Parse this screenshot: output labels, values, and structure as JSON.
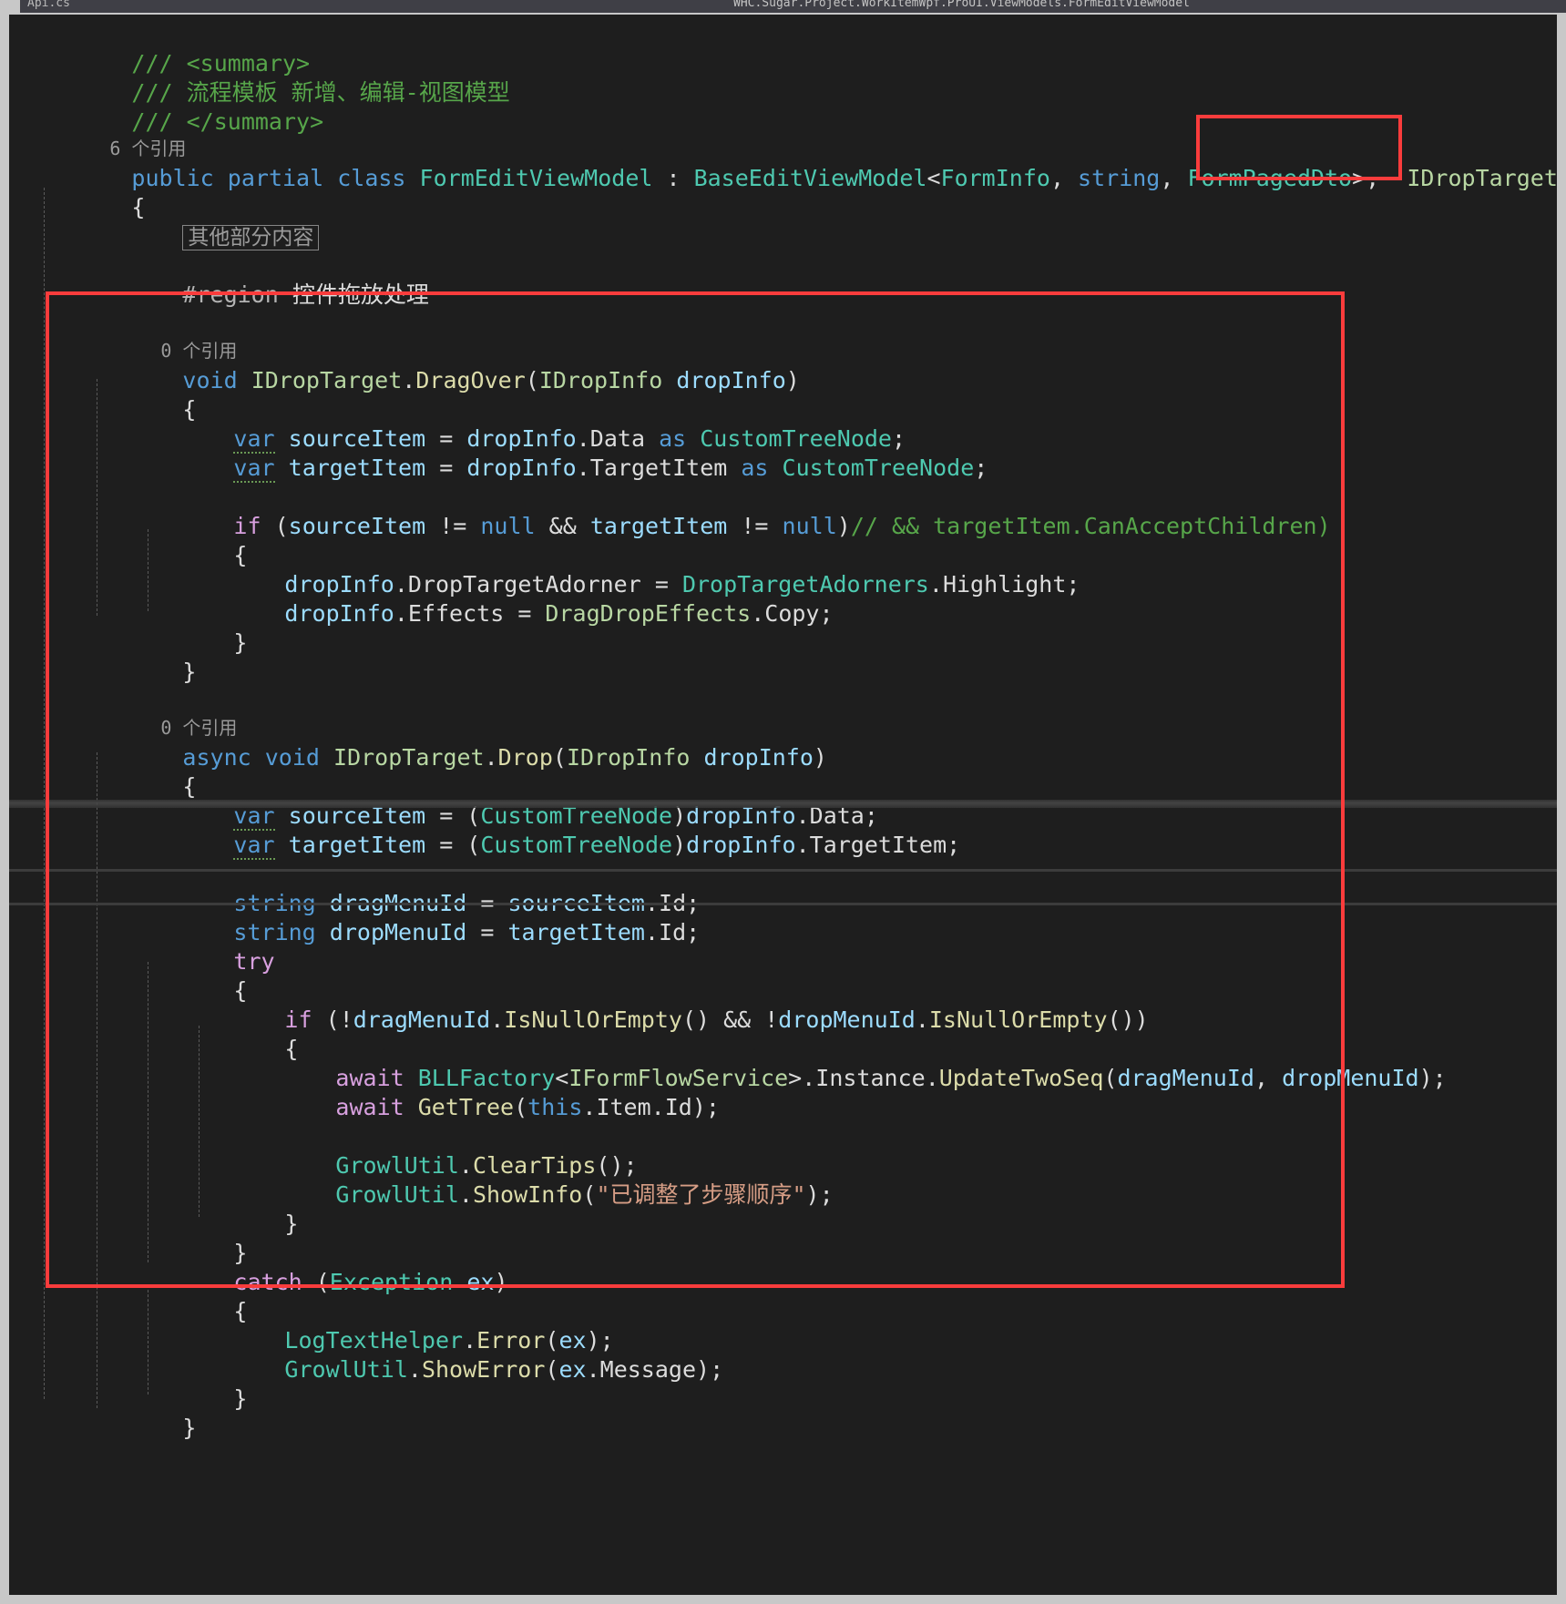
{
  "window": {
    "tab_left_label": "Api.cs",
    "tab_right_label": "WHC.Sugar.Project.WorkItemWpf.ProUI.ViewModels.FormEditViewModel"
  },
  "editor": {
    "language": "csharp",
    "theme": "dark",
    "background": "#1e1e1e",
    "annotation_color": "#fa3c3c",
    "collapsed_region_label": "其他部分内容",
    "lines": [
      {
        "id": "l1",
        "indent": 0,
        "text": "/// <summary>"
      },
      {
        "id": "l2",
        "indent": 0,
        "text": "/// 流程模板 新增、编辑-视图模型"
      },
      {
        "id": "l3",
        "indent": 0,
        "text": "/// </summary>"
      },
      {
        "id": "l4",
        "indent": 0,
        "text": "6 个引用",
        "kind": "codelens"
      },
      {
        "id": "l5",
        "indent": 0,
        "text": "public partial class FormEditViewModel : BaseEditViewModel<FormInfo, string, FormPagedDto>, IDropTarget"
      },
      {
        "id": "l6",
        "indent": 0,
        "text": "{"
      },
      {
        "id": "l7",
        "indent": 1,
        "text": "其他部分内容",
        "kind": "collapsed"
      },
      {
        "id": "l8",
        "indent": 1,
        "text": ""
      },
      {
        "id": "l9",
        "indent": 1,
        "text": "#region 控件拖放处理"
      },
      {
        "id": "l10",
        "indent": 1,
        "text": ""
      },
      {
        "id": "l11",
        "indent": 1,
        "text": "0 个引用",
        "kind": "codelens"
      },
      {
        "id": "l12",
        "indent": 1,
        "text": "void IDropTarget.DragOver(IDropInfo dropInfo)"
      },
      {
        "id": "l13",
        "indent": 1,
        "text": "{"
      },
      {
        "id": "l14",
        "indent": 2,
        "text": "var sourceItem = dropInfo.Data as CustomTreeNode;"
      },
      {
        "id": "l15",
        "indent": 2,
        "text": "var targetItem = dropInfo.TargetItem as CustomTreeNode;"
      },
      {
        "id": "l16",
        "indent": 2,
        "text": ""
      },
      {
        "id": "l17",
        "indent": 2,
        "text": "if (sourceItem != null && targetItem != null)// && targetItem.CanAcceptChildren)"
      },
      {
        "id": "l18",
        "indent": 2,
        "text": "{"
      },
      {
        "id": "l19",
        "indent": 3,
        "text": "dropInfo.DropTargetAdorner = DropTargetAdorners.Highlight;"
      },
      {
        "id": "l20",
        "indent": 3,
        "text": "dropInfo.Effects = DragDropEffects.Copy;"
      },
      {
        "id": "l21",
        "indent": 2,
        "text": "}"
      },
      {
        "id": "l22",
        "indent": 1,
        "text": "}"
      },
      {
        "id": "l23",
        "indent": 1,
        "text": ""
      },
      {
        "id": "l24",
        "indent": 1,
        "text": "0 个引用",
        "kind": "codelens"
      },
      {
        "id": "l25",
        "indent": 1,
        "text": "async void IDropTarget.Drop(IDropInfo dropInfo)"
      },
      {
        "id": "l26",
        "indent": 1,
        "text": "{"
      },
      {
        "id": "l27",
        "indent": 2,
        "text": "var sourceItem = (CustomTreeNode)dropInfo.Data;"
      },
      {
        "id": "l28",
        "indent": 2,
        "text": "var targetItem = (CustomTreeNode)dropInfo.TargetItem;"
      },
      {
        "id": "l29",
        "indent": 2,
        "text": ""
      },
      {
        "id": "l30",
        "indent": 2,
        "text": "string dragMenuId = sourceItem.Id;"
      },
      {
        "id": "l31",
        "indent": 2,
        "text": "string dropMenuId = targetItem.Id;"
      },
      {
        "id": "l32",
        "indent": 2,
        "text": "try"
      },
      {
        "id": "l33",
        "indent": 2,
        "text": "{"
      },
      {
        "id": "l34",
        "indent": 3,
        "text": "if (!dragMenuId.IsNullOrEmpty() && !dropMenuId.IsNullOrEmpty())"
      },
      {
        "id": "l35",
        "indent": 3,
        "text": "{"
      },
      {
        "id": "l36",
        "indent": 4,
        "text": "await BLLFactory<IFormFlowService>.Instance.UpdateTwoSeq(dragMenuId, dropMenuId);"
      },
      {
        "id": "l37",
        "indent": 4,
        "text": "await GetTree(this.Item.Id);"
      },
      {
        "id": "l38",
        "indent": 4,
        "text": ""
      },
      {
        "id": "l39",
        "indent": 4,
        "text": "GrowlUtil.ClearTips();"
      },
      {
        "id": "l40",
        "indent": 4,
        "text": "GrowlUtil.ShowInfo(\"已调整了步骤顺序\");"
      },
      {
        "id": "l41",
        "indent": 3,
        "text": "}"
      },
      {
        "id": "l42",
        "indent": 2,
        "text": "}"
      },
      {
        "id": "l43",
        "indent": 2,
        "text": "catch (Exception ex)"
      },
      {
        "id": "l44",
        "indent": 2,
        "text": "{"
      },
      {
        "id": "l45",
        "indent": 3,
        "text": "LogTextHelper.Error(ex);"
      },
      {
        "id": "l46",
        "indent": 3,
        "text": "GrowlUtil.ShowError(ex.Message);"
      },
      {
        "id": "l47",
        "indent": 2,
        "text": "}"
      },
      {
        "id": "l48",
        "indent": 1,
        "text": "}"
      }
    ],
    "code_lens_labels": [
      "6 个引用",
      "0 个引用",
      "0 个引用"
    ],
    "strings": [
      "已调整了步骤顺序"
    ],
    "region_directive": "#region",
    "region_name": "控件拖放处理"
  },
  "annotations": [
    {
      "name": "idroptarget-highlight",
      "label": "IDropTarget"
    },
    {
      "name": "drag-drop-methods-highlight",
      "label": ""
    }
  ]
}
